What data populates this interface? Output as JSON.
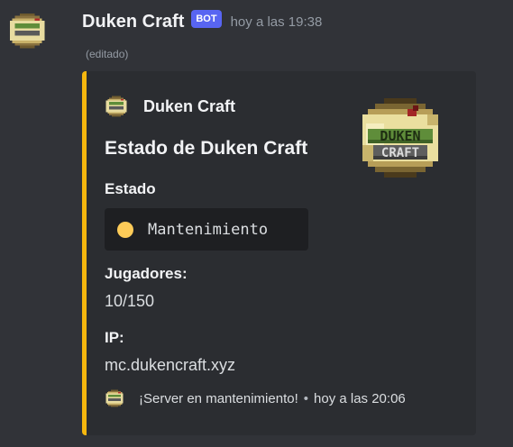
{
  "message": {
    "author": "Duken Craft",
    "bot_tag": "BOT",
    "timestamp": "hoy a las 19:38",
    "edited": "(editado)",
    "avatar_icon": "duken-craft-logo-icon"
  },
  "embed": {
    "accent_color": "#f6b70e",
    "author_name": "Duken Craft",
    "title": "Estado de Duken Craft",
    "thumbnail_icon": "duken-craft-logo-icon",
    "thumbnail_text_1": "DUKEN",
    "thumbnail_text_2": "CRAFT",
    "fields": [
      {
        "name": "Estado",
        "value": "Mantenimiento",
        "status_icon": "yellow-circle-icon",
        "status_color": "#fdcb58"
      },
      {
        "name": "Jugadores:",
        "value": "10/150"
      },
      {
        "name": "IP:",
        "value": "mc.dukencraft.xyz"
      }
    ],
    "footer": {
      "text": "¡Server en mantenimiento!",
      "separator": "•",
      "timestamp": "hoy a las 20:06"
    }
  },
  "colors": {
    "background": "#313338",
    "embed_background": "#2b2d31",
    "bot_tag": "#5865f2"
  }
}
